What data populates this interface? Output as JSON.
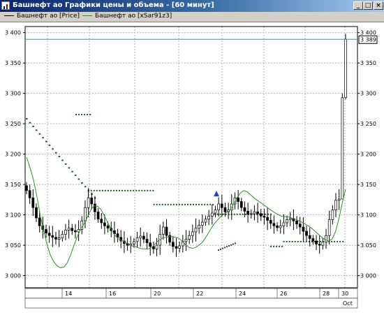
{
  "window": {
    "title": "Башнефт ао Графики цены и объема - [60 минут]",
    "minimize": "_",
    "maximize": "□",
    "close": "×"
  },
  "legend": [
    {
      "label": "Башнефт ао [Price]",
      "color": "#000000"
    },
    {
      "label": "Башнефт ао [xSar91z3]",
      "color": "#2f8f2f"
    }
  ],
  "colors": {
    "price": "#000000",
    "ma": "#2f8f2f",
    "sar": "#1a5a1a",
    "last_line": "#3c8fa0",
    "marker": "#1f3fd0"
  },
  "chart_data": {
    "type": "candlestick",
    "ylim": [
      2980,
      3410
    ],
    "yticks": [
      "3 000",
      "3 050",
      "3 100",
      "3 150",
      "3 200",
      "3 250",
      "3 300",
      "3 350",
      "3 400"
    ],
    "ytick_values": [
      3000,
      3050,
      3100,
      3150,
      3200,
      3250,
      3300,
      3350,
      3400
    ],
    "xticks": [
      "14",
      "16",
      "20",
      "22",
      "24",
      "26",
      "28",
      "30"
    ],
    "x_bottom_label": "Oct",
    "last_price": 3389,
    "last_price_label": "3 389",
    "close": [
      3140,
      3128,
      3112,
      3095,
      3082,
      3076,
      3070,
      3066,
      3063,
      3060,
      3062,
      3068,
      3075,
      3078,
      3074,
      3072,
      3076,
      3090,
      3112,
      3128,
      3118,
      3105,
      3093,
      3087,
      3082,
      3078,
      3074,
      3069,
      3063,
      3057,
      3053,
      3050,
      3052,
      3056,
      3062,
      3065,
      3060,
      3054,
      3048,
      3044,
      3050,
      3068,
      3080,
      3066,
      3055,
      3048,
      3045,
      3049,
      3056,
      3060,
      3066,
      3072,
      3078,
      3083,
      3088,
      3093,
      3098,
      3103,
      3108,
      3118,
      3112,
      3105,
      3108,
      3118,
      3128,
      3122,
      3112,
      3106,
      3101,
      3102,
      3105,
      3102,
      3098,
      3096,
      3091,
      3086,
      3082,
      3079,
      3082,
      3087,
      3092,
      3094,
      3090,
      3085,
      3080,
      3073,
      3066,
      3061,
      3057,
      3052,
      3050,
      3055,
      3066,
      3092,
      3108,
      3124,
      3126,
      3293,
      3389
    ],
    "ma": [
      3195,
      3178,
      3159,
      3132,
      3101,
      3075,
      3052,
      3034,
      3023,
      3016,
      3013,
      3014,
      3021,
      3034,
      3050,
      3065,
      3077,
      3086,
      3097,
      3109,
      3115,
      3114,
      3108,
      3098,
      3086,
      3076,
      3067,
      3061,
      3058,
      3055,
      3052,
      3049,
      3048,
      3046,
      3044,
      3044,
      3044,
      3047,
      3053,
      3058,
      3062,
      3063,
      3064,
      3064,
      3063,
      3061,
      3056,
      3050,
      3046,
      3045,
      3047,
      3051,
      3056,
      3065,
      3074,
      3083,
      3090,
      3096,
      3101,
      3104,
      3108,
      3117,
      3128,
      3136,
      3140,
      3138,
      3133,
      3128,
      3124,
      3120,
      3116,
      3112,
      3108,
      3104,
      3101,
      3098,
      3097,
      3097,
      3095,
      3093,
      3091,
      3088,
      3085,
      3082,
      3078,
      3073,
      3068,
      3063,
      3059,
      3057,
      3060,
      3072,
      3093,
      3119,
      3142
    ],
    "sar": [
      [
        3265,
        0,
        7
      ],
      [
        3140,
        7,
        36
      ],
      [
        3117,
        36,
        64
      ],
      [
        3101,
        64,
        90
      ],
      [
        3048,
        90,
        96
      ],
      [
        3056,
        96,
        147
      ]
    ],
    "sar_upper_start": 3258
  }
}
